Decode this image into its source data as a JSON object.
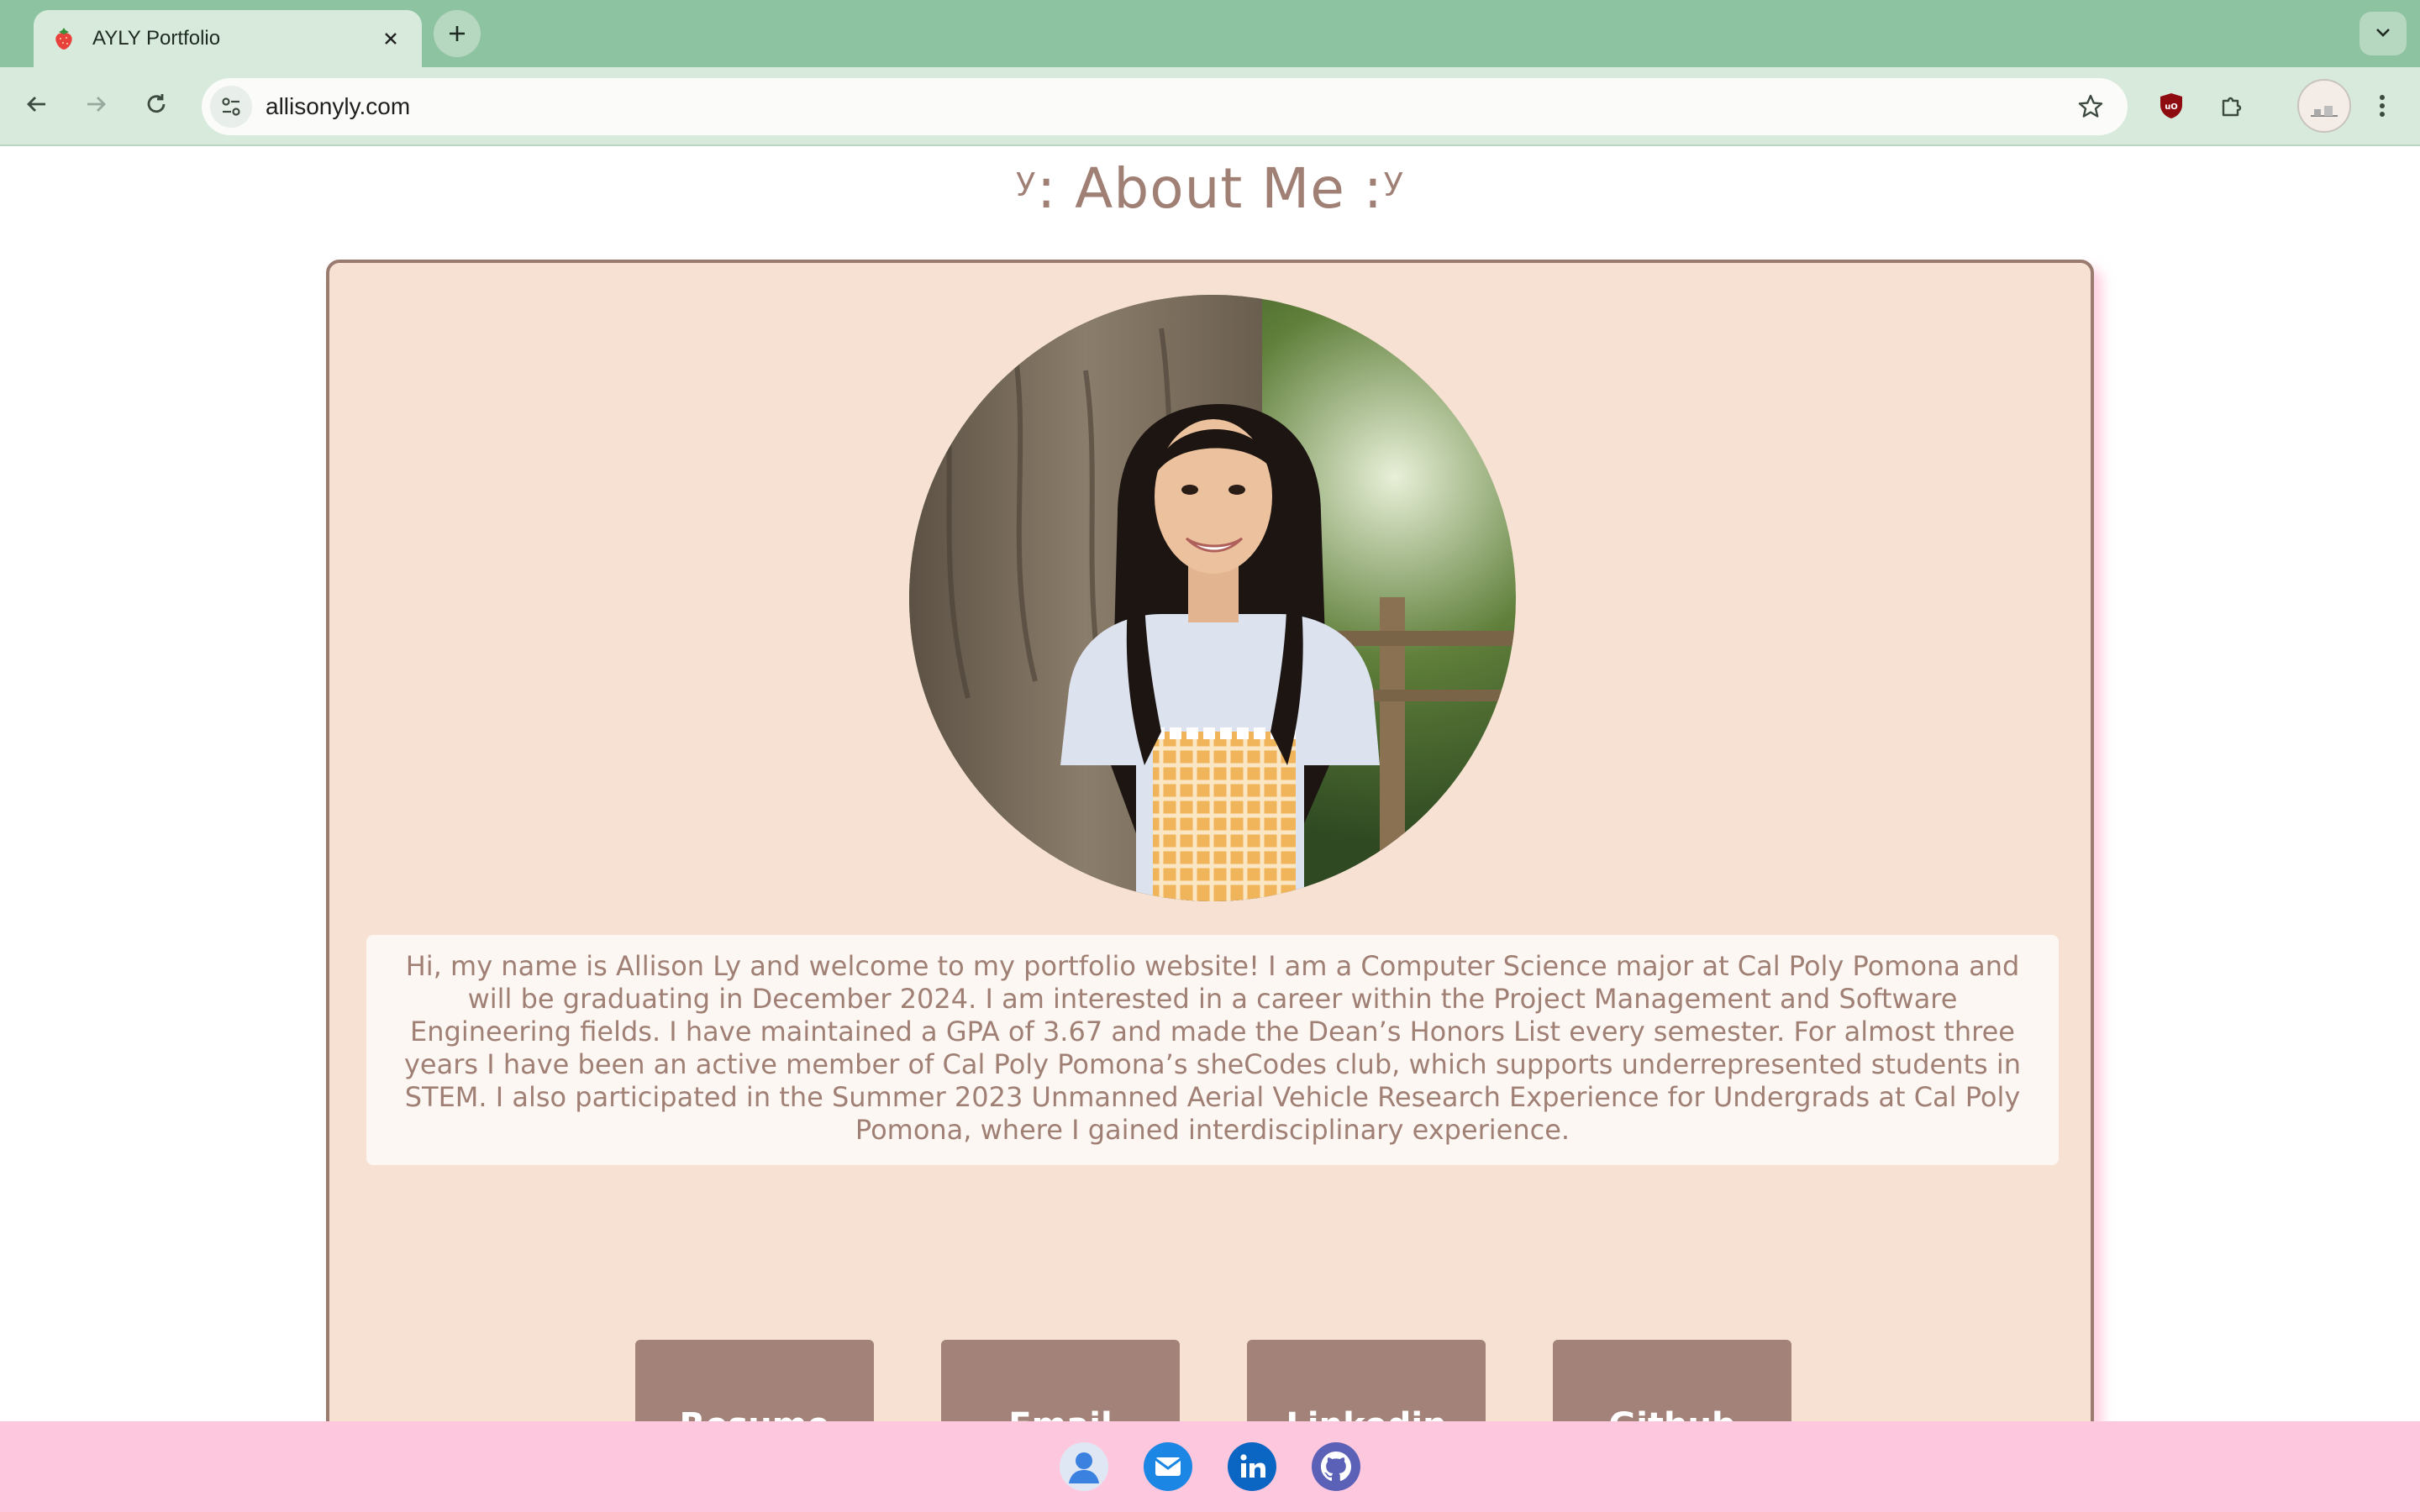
{
  "browser": {
    "tab_title": "AYLY Portfolio",
    "tab_favicon": "strawberry-icon",
    "url": "allisonyly.com"
  },
  "page": {
    "heading": "ʸ: About Me :ʸ",
    "bio": "Hi, my name is Allison Ly and welcome to my portfolio website! I am a Computer Science major at Cal Poly Pomona and will be graduating in December 2024. I am interested in a career within the Project Management and Software Engineering fields. I have maintained a GPA of 3.67 and made the Dean’s Honors List every semester. For almost three years I have been an active member of Cal Poly Pomona’s sheCodes club, which supports underrepresented students in STEM. I also participated in the Summer 2023 Unmanned Aerial Vehicle Research Experience for Undergrads at Cal Poly Pomona, where I gained interdisciplinary experience.",
    "buttons": {
      "resume": "Resume",
      "email": "Email",
      "linkedin": "Linkedin",
      "github": "Github"
    },
    "footer_icons": [
      "person-icon",
      "mail-icon",
      "linkedin-icon",
      "github-icon"
    ]
  },
  "colors": {
    "tabstrip": "#8dc3a0",
    "heading_text": "#a07f74",
    "card_bg": "#f6e1d2",
    "button_bg": "#a38379",
    "footer_bg": "#fdc8de"
  }
}
